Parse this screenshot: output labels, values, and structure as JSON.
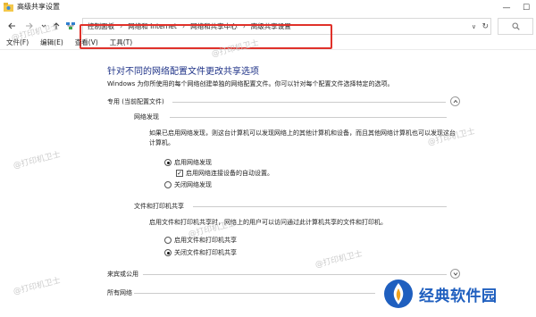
{
  "window": {
    "title": "高级共享设置",
    "minimize": "—",
    "maximize": "☐"
  },
  "address": {
    "breadcrumbs": [
      "控制面板",
      "网络和 Internet",
      "网络和共享中心",
      "高级共享设置"
    ],
    "separator": "›",
    "dropdown": "∨",
    "refresh": "↻",
    "search_icon": "search-icon"
  },
  "menu": [
    "文件(F)",
    "编辑(E)",
    "查看(V)",
    "工具(T)"
  ],
  "page": {
    "heading": "针对不同的网络配置文件更改共享选项",
    "description": "Windows 为你所使用的每个网络创建单独的网络配置文件。你可以针对每个配置文件选择特定的选项。"
  },
  "profiles": {
    "private": {
      "label": "专用 (当前配置文件)",
      "discovery": {
        "label": "网络发现",
        "text": "如果已启用网络发现，则这台计算机可以发现网络上的其他计算机和设备，而且其他网络计算机也可以发现这台计算机。",
        "on": "启用网络发现",
        "auto": "启用网络连接设备的自动设置。",
        "off": "关闭网络发现"
      },
      "sharing": {
        "label": "文件和打印机共享",
        "text": "启用文件和打印机共享时，网络上的用户可以访问通过此计算机共享的文件和打印机。",
        "on": "启用文件和打印机共享",
        "off": "关闭文件和打印机共享"
      }
    },
    "guest": {
      "label": "来宾或公用"
    },
    "all": {
      "label": "所有网络"
    }
  },
  "watermark": "@打印机卫士",
  "brand": {
    "name": "经典软件园"
  },
  "colors": {
    "accent": "#1e3287",
    "highlight": "#e0312a",
    "brand": "#1f5fbf"
  }
}
